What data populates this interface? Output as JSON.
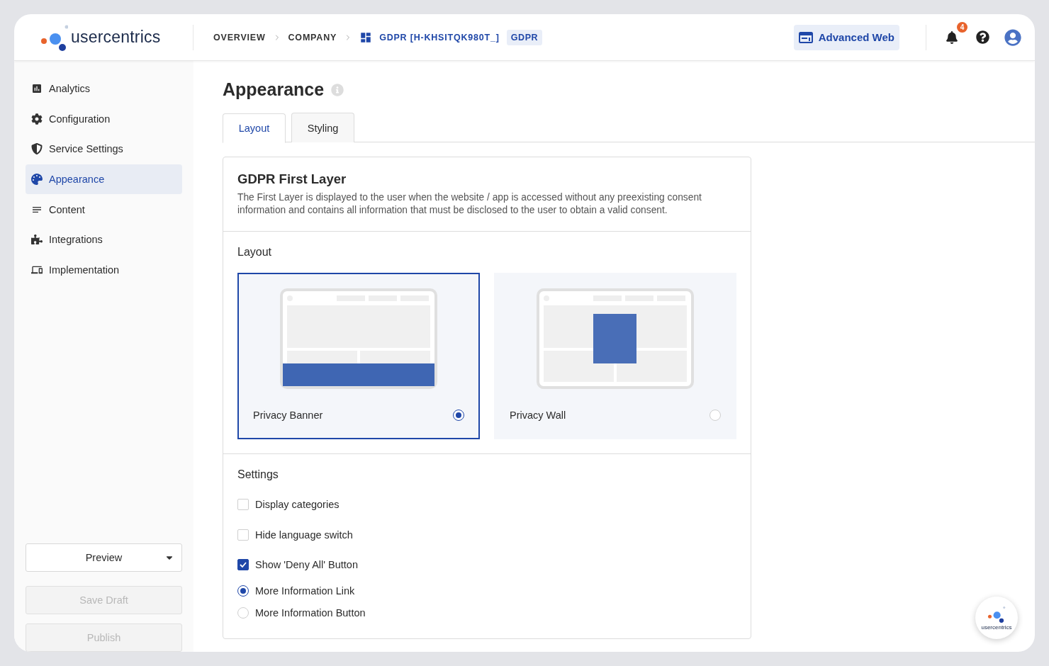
{
  "logo": {
    "text": "usercentrics"
  },
  "breadcrumb": [
    {
      "label": "OVERVIEW",
      "kind": "plain"
    },
    {
      "label": "COMPANY",
      "kind": "plain"
    },
    {
      "label": "GDPR [H-KHSITQK980T_]",
      "kind": "link"
    }
  ],
  "breadcrumb_tag": "GDPR",
  "plan_button": {
    "label": "Advanced Web"
  },
  "notifications": {
    "count": "4"
  },
  "sidebar": {
    "items": [
      {
        "label": "Analytics",
        "kind": "chart",
        "selected": false
      },
      {
        "label": "Configuration",
        "kind": "gear",
        "selected": false
      },
      {
        "label": "Service Settings",
        "kind": "shield",
        "selected": false
      },
      {
        "label": "Appearance",
        "kind": "palette",
        "selected": true
      },
      {
        "label": "Content",
        "kind": "lines",
        "selected": false
      },
      {
        "label": "Integrations",
        "kind": "puzzle",
        "selected": false
      },
      {
        "label": "Implementation",
        "kind": "devices",
        "selected": false
      }
    ],
    "preview": {
      "label": "Preview"
    },
    "actions": [
      {
        "label": "Save Draft",
        "disabled": true
      },
      {
        "label": "Publish",
        "disabled": true
      }
    ]
  },
  "page": {
    "title": "Appearance",
    "tabs": [
      {
        "label": "Layout",
        "selected": true
      },
      {
        "label": "Styling",
        "selected": false
      }
    ]
  },
  "card": {
    "title": "GDPR First Layer",
    "description": "The First Layer is displayed to the user when the website / app is accessed without any preexisting consent information and contains all information that must be disclosed to the user to obtain a valid consent.",
    "layout": {
      "heading": "Layout",
      "options": [
        {
          "label": "Privacy Banner",
          "kind": "banner",
          "selected": true
        },
        {
          "label": "Privacy Wall",
          "kind": "wall",
          "selected": false
        }
      ]
    },
    "settings": {
      "heading": "Settings",
      "checkboxes": [
        {
          "label": "Display categories",
          "checked": false
        },
        {
          "label": "Hide language switch",
          "checked": false
        },
        {
          "label": "Show 'Deny All' Button",
          "checked": true
        }
      ],
      "radios": [
        {
          "label": "More Information Link",
          "selected": true
        },
        {
          "label": "More Information Button",
          "selected": false
        }
      ]
    }
  },
  "chat_badge": {
    "text": "usercentrics"
  }
}
